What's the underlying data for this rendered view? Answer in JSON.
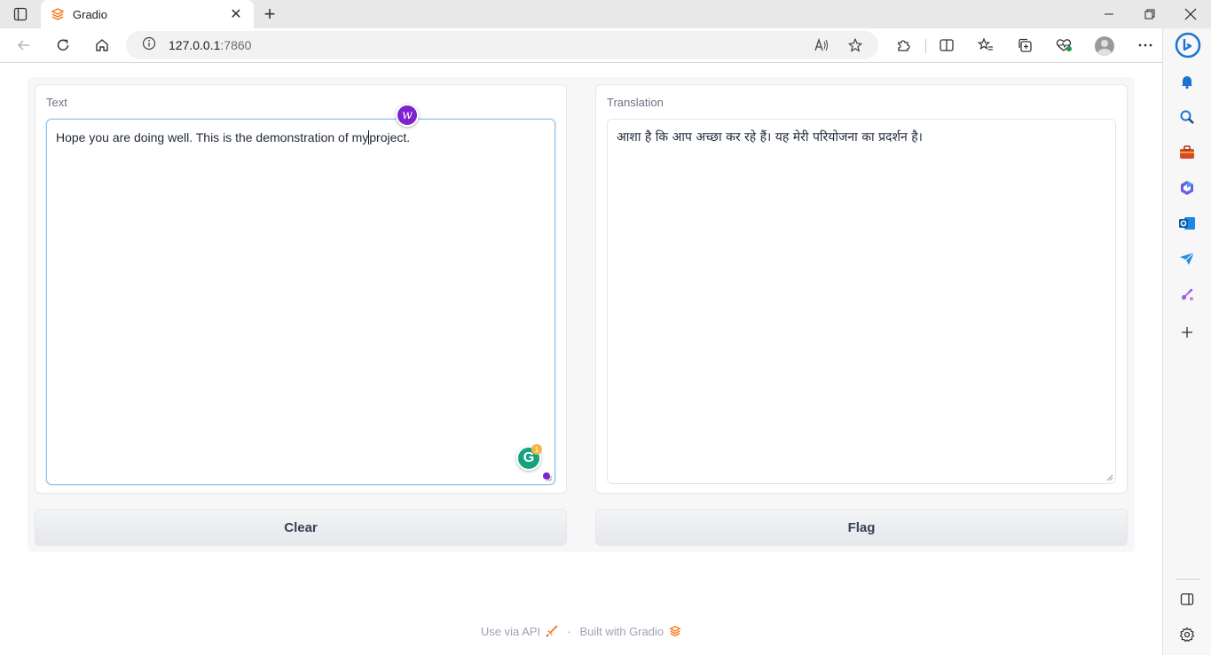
{
  "browser": {
    "tab_title": "Gradio",
    "url_host": "127.0.0.1",
    "url_port": ":7860"
  },
  "app": {
    "input": {
      "label": "Text",
      "value_before_caret": "Hope you are doing well. This is the demonstration of my",
      "value_after_caret": "project."
    },
    "output": {
      "label": "Translation",
      "value": "आशा है कि आप अच्छा कर रहे हैं। यह मेरी परियोजना का प्रदर्शन है।"
    },
    "clear_label": "Clear",
    "flag_label": "Flag",
    "grammarly_count": "1",
    "word_badge_letter": "w"
  },
  "footer": {
    "api_text": "Use via API",
    "separator": "·",
    "built_text": "Built with Gradio"
  },
  "colors": {
    "gradio_orange": "#f97316",
    "edge_blue": "#1b74d4",
    "focus_border": "#8ec5ef",
    "grammarly_green": "#15a37f",
    "badge_purple": "#7e22ce"
  }
}
